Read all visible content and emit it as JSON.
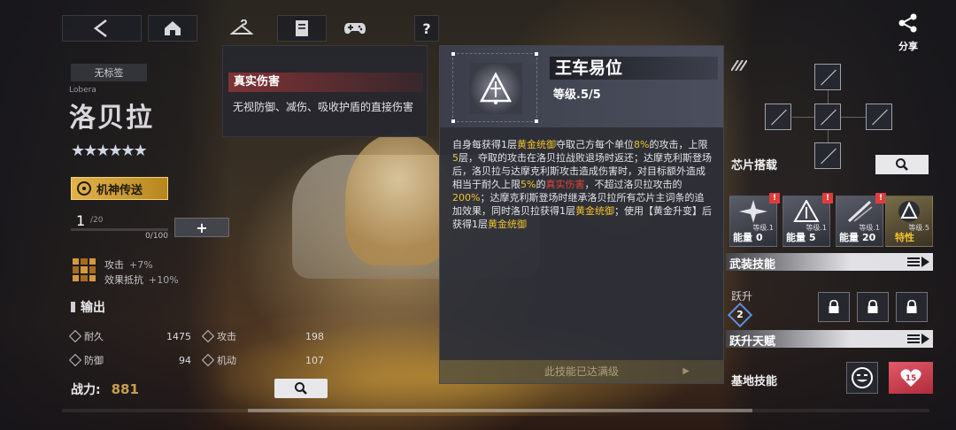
{
  "character": {
    "tag": "无标签",
    "name_en": "Lobera",
    "name_cn": "洛贝拉",
    "stars": "★★★★★★",
    "mech_button": "机神传送",
    "level": "1",
    "level_max": "/20",
    "exp": "0/100",
    "upgrade_button": "+",
    "bonuses": [
      {
        "label": "攻击",
        "value": "+7%"
      },
      {
        "label": "效果抵抗",
        "value": "+10%"
      }
    ],
    "role": "输出",
    "stats": [
      {
        "label": "耐久",
        "value": "1475"
      },
      {
        "label": "攻击",
        "value": "198"
      },
      {
        "label": "防御",
        "value": "94"
      },
      {
        "label": "机动",
        "value": "107"
      }
    ],
    "power_label": "战力:",
    "power_value": "881"
  },
  "share": {
    "label": "分享"
  },
  "tooltip": {
    "title": "真实伤害",
    "description": "无视防御、减伤、吸收护盾的直接伤害"
  },
  "skill": {
    "name": "王车易位",
    "level": "等级.5/5",
    "desc_parts": [
      {
        "t": "自身每获得1层",
        "c": ""
      },
      {
        "t": "黄金统御",
        "c": "gold"
      },
      {
        "t": "夺取己方每个单位",
        "c": ""
      },
      {
        "t": "8%",
        "c": "gold"
      },
      {
        "t": "的攻击，上限",
        "c": ""
      },
      {
        "t": "5",
        "c": "gold"
      },
      {
        "t": "层，夺取的攻击在洛贝拉战败退场时返还；达摩克利斯登场后，洛贝拉与达摩克利斯攻击造成伤害时，对目标额外造成相当于耐久上限",
        "c": ""
      },
      {
        "t": "5%",
        "c": "gold"
      },
      {
        "t": "的",
        "c": ""
      },
      {
        "t": "真实伤害",
        "c": "red"
      },
      {
        "t": "，不超过洛贝拉攻击的",
        "c": ""
      },
      {
        "t": "200%",
        "c": "gold"
      },
      {
        "t": "；达摩克利斯登场时继承洛贝拉所有芯片主词条的追加效果，同时洛贝拉获得1层",
        "c": ""
      },
      {
        "t": "黄金统御",
        "c": "gold"
      },
      {
        "t": "；使用【黄金升变】后获得1层",
        "c": ""
      },
      {
        "t": "黄金统御",
        "c": "gold"
      }
    ],
    "maxed_text": "此技能已达满级"
  },
  "right_panel": {
    "chip_label": "芯片搭载",
    "skill_cards": [
      {
        "level_label": "等级.1",
        "energy_label": "能量",
        "energy": "0",
        "alert": "!"
      },
      {
        "level_label": "等级.1",
        "energy_label": "能量",
        "energy": "5",
        "alert": "!"
      },
      {
        "level_label": "等级.1",
        "energy_label": "能量",
        "energy": "20",
        "alert": "!"
      },
      {
        "level_label": "等级.5",
        "trait": "特性"
      }
    ],
    "armed_skill_label": "武装技能",
    "leap_label": "跃升",
    "leap_level": "2",
    "leap_talent_label": "跃升天赋",
    "base_skill_label": "基地技能",
    "heart_count": "15"
  },
  "colors": {
    "gold_text": "#f2c230",
    "red_text": "#e5443a",
    "mech_button": "#e2b34a",
    "heart": "#e35a6a"
  },
  "icons": [
    "back-icon",
    "home-icon",
    "hanger-icon",
    "document-icon",
    "gamepad-icon",
    "help-icon",
    "share-icon",
    "zoom-icon",
    "lock-icon",
    "emote-icon",
    "heart-icon"
  ]
}
